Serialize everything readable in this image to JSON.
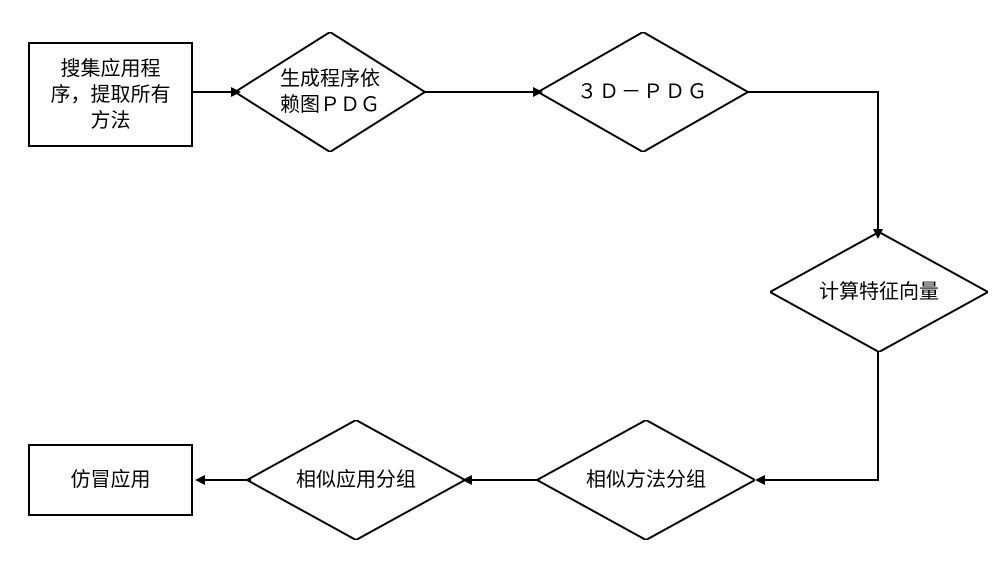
{
  "diagram": {
    "type": "flowchart",
    "nodes": {
      "start": {
        "shape": "rectangle",
        "label": "搜集应用程\n序，提取所有\n方法"
      },
      "pdg": {
        "shape": "diamond",
        "label": "生成程序依\n赖图ＰＤＧ"
      },
      "pdg3d": {
        "shape": "diamond",
        "label": "３Ｄ－ＰＤＧ"
      },
      "feature": {
        "shape": "diamond",
        "label": "计算特征向量"
      },
      "method_group": {
        "shape": "diamond",
        "label": "相似方法分组"
      },
      "app_group": {
        "shape": "diamond",
        "label": "相似应用分组"
      },
      "end": {
        "shape": "rectangle",
        "label": "仿冒应用"
      }
    },
    "edges": [
      {
        "from": "start",
        "to": "pdg"
      },
      {
        "from": "pdg",
        "to": "pdg3d"
      },
      {
        "from": "pdg3d",
        "to": "feature"
      },
      {
        "from": "feature",
        "to": "method_group"
      },
      {
        "from": "method_group",
        "to": "app_group"
      },
      {
        "from": "app_group",
        "to": "end"
      }
    ]
  }
}
